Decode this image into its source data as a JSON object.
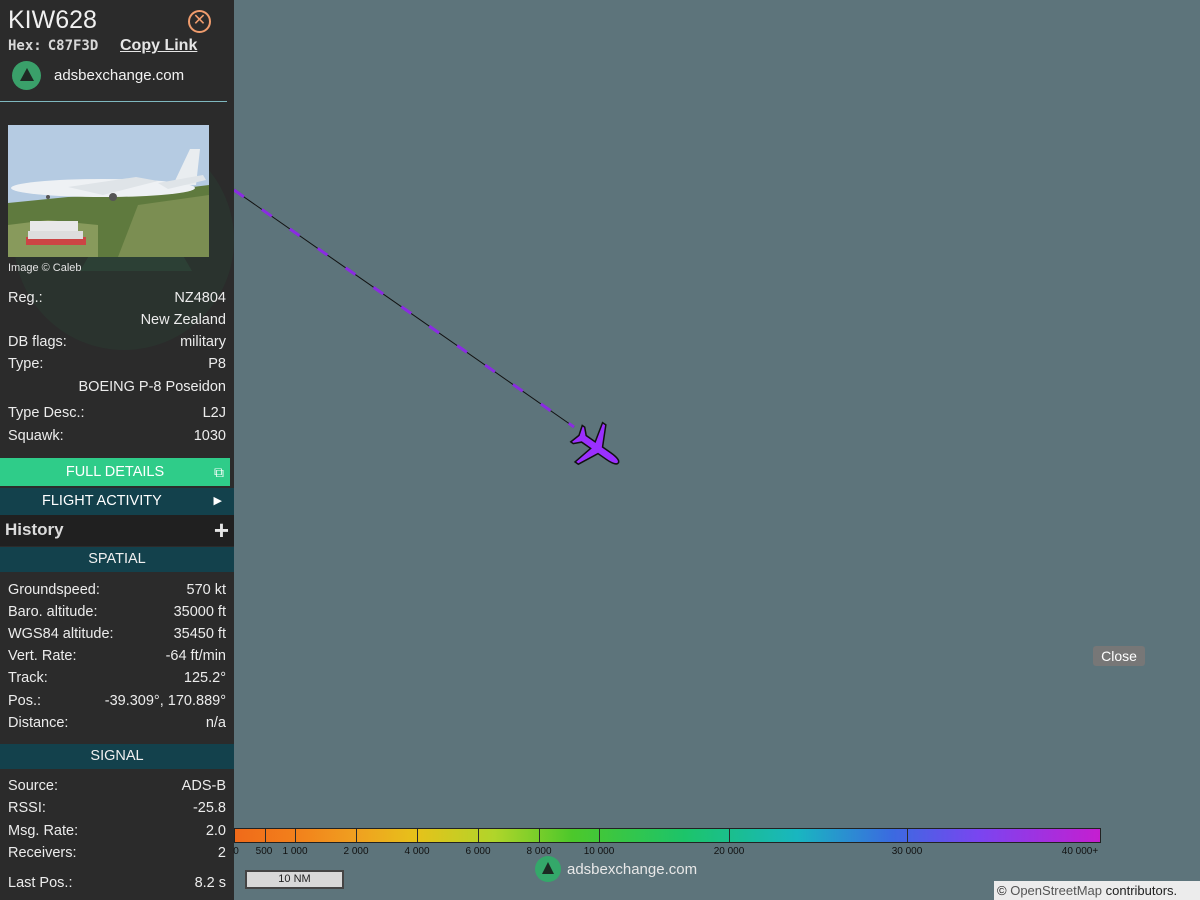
{
  "sidebar": {
    "callsign": "KIW628",
    "hex_label": "Hex:",
    "hex": "C87F3D",
    "copy_link": "Copy Link",
    "site": "adsbexchange.com",
    "image_credit": "Image © Caleb",
    "info": {
      "reg_label": "Reg.:",
      "reg": "NZ4804",
      "country": "New Zealand",
      "dbflags_label": "DB flags:",
      "dbflags": "military",
      "type_label": "Type:",
      "type": "P8",
      "type_full": "BOEING P-8 Poseidon",
      "typedesc_label": "Type Desc.:",
      "typedesc": "L2J",
      "squawk_label": "Squawk:",
      "squawk": "1030"
    },
    "buttons": {
      "full_details": "FULL DETAILS",
      "flight_activity": "FLIGHT ACTIVITY",
      "history": "History"
    },
    "spatial": {
      "title": "SPATIAL",
      "groundspeed_label": "Groundspeed:",
      "groundspeed": "570 kt",
      "baro_label": "Baro. altitude:",
      "baro": "35000 ft",
      "wgs_label": "WGS84 altitude:",
      "wgs": "35450 ft",
      "vrate_label": "Vert. Rate:",
      "vrate": "-64 ft/min",
      "track_label": "Track:",
      "track": "125.2°",
      "pos_label": "Pos.:",
      "pos": "-39.309°, 170.889°",
      "distance_label": "Distance:",
      "distance": "n/a"
    },
    "signal": {
      "title": "SIGNAL",
      "source_label": "Source:",
      "source": "ADS-B",
      "rssi_label": "RSSI:",
      "rssi": "-25.8",
      "msgrate_label": "Msg. Rate:",
      "msgrate": "2.0",
      "receivers_label": "Receivers:",
      "receivers": "2",
      "lastpos_label": "Last Pos.:",
      "lastpos": "8.2 s"
    }
  },
  "map": {
    "close": "Close",
    "scale_labels": [
      "0",
      "500",
      "1 000",
      "2 000",
      "4 000",
      "6 000",
      "8 000",
      "10 000",
      "20 000",
      "30 000",
      "40 000+"
    ],
    "distance_scale": "10 NM",
    "watermark": "adsbexchange.com",
    "attribution_prefix": "©",
    "attribution_osm": "OpenStreetMap",
    "attribution_suffix": "contributors.",
    "trail_color": "#8a2be2",
    "aircraft_color": "#9b30ff"
  }
}
